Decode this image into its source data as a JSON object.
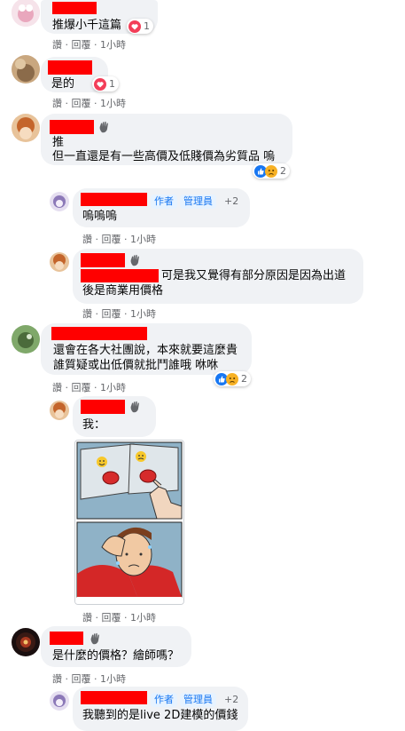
{
  "comments": [
    {
      "text": "推爆小千這篇",
      "reaction_count": "1",
      "actions": {
        "like": "讚",
        "reply": "回覆",
        "time": "1小時"
      }
    },
    {
      "text": "是的",
      "reaction_count": "1",
      "actions": {
        "like": "讚",
        "reply": "回覆",
        "time": "1小時"
      }
    },
    {
      "line1": "推",
      "line2": "但一直還是有一些高價及低賤價為劣質品 嗚",
      "reaction_count": "2",
      "actions": {
        "like": "讚",
        "reply": "回覆",
        "time": "1小時"
      }
    },
    {
      "text": "嗚嗚嗚",
      "badge_author": "作者",
      "badge_admin": "管理員",
      "badge_more": "+2",
      "actions": {
        "like": "讚",
        "reply": "回覆",
        "time": "1小時"
      }
    },
    {
      "line1": "可是我又覺得有部分原因是因為出道",
      "line2": "後是商業用價格",
      "actions": {
        "like": "讚",
        "reply": "回覆",
        "time": "1小時"
      }
    },
    {
      "line1": "還會在各大社團說，本來就要這麼貴",
      "line2": "誰質疑或出低價就批鬥誰哦 咻咻",
      "reaction_count": "2",
      "actions": {
        "like": "讚",
        "reply": "回覆",
        "time": "1小時"
      }
    },
    {
      "text": "我：",
      "actions": {
        "like": "讚",
        "reply": "回覆",
        "time": "1小時"
      }
    },
    {
      "text": "是什麼的價格？繪師嗎？",
      "actions": {
        "like": "讚",
        "reply": "回覆",
        "time": "1小時"
      }
    },
    {
      "text": "我聽到的是live 2D建模的價錢",
      "badge_author": "作者",
      "badge_admin": "管理員",
      "badge_more": "+2"
    }
  ],
  "colors": {
    "bubble": "#f0f2f5",
    "redaction": "#ff0000",
    "meta": "#65676b",
    "badge_text": "#1877f2",
    "badge_bg": "#e7f3ff"
  },
  "icons": [
    "wave-icon",
    "heart-reaction-icon",
    "like-reaction-icon",
    "sad-reaction-icon",
    "avatar"
  ]
}
